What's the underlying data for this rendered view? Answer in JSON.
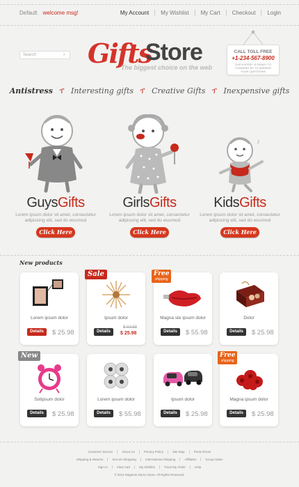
{
  "topbar": {
    "language": "Default",
    "welcome": "welcome msg!",
    "nav": [
      "My Account",
      "My Wishlist",
      "My Cart",
      "Checkout",
      "Login"
    ]
  },
  "search": {
    "placeholder": "Search"
  },
  "logo": {
    "part1": "Gifts",
    "part2": "Store",
    "tagline": "The biggest choice on the web"
  },
  "callbox": {
    "title": "CALL TOLL FREE",
    "phone": "+1-234-567-8900",
    "note": "OUR EXPERT IS READY TO STANDING BY TO ANSWER YOUR QUESTIONS"
  },
  "categories": [
    "Antistress",
    "Interesting gifts",
    "Creative Gifts",
    "Inexpensive gifts"
  ],
  "hero": [
    {
      "a": "Guys",
      "b": "Gifts",
      "desc1": "Lorem ipsum dolor sit amet, consectetur",
      "desc2": "adipiscing elit, sed do eiusmod",
      "button": "Click Here"
    },
    {
      "a": "Girls",
      "b": "Gifts",
      "desc1": "Lorem ipsum dolor sit amet, consectetur",
      "desc2": "adipiscing elit, sed do eiusmod",
      "button": "Click Here"
    },
    {
      "a": "Kids",
      "b": "Gifts",
      "desc1": "Lorem ipsum dolor sit amet, consectetur",
      "desc2": "adipiscing elit, sed do eiusmod",
      "button": "Click Here"
    }
  ],
  "new_products_title": "New products",
  "products": [
    {
      "name": "Lorem ipsum dolor",
      "details": "Details",
      "price": "$ 25.98",
      "badge": "",
      "icon": "photo-frame-icon"
    },
    {
      "name": "Ipsum dolor",
      "details": "Details",
      "old_price": "$ 32.58",
      "price": "$ 25.98",
      "badge": "Sale",
      "icon": "sun-clock-icon"
    },
    {
      "name": "Magna ste ipsum dolor",
      "details": "Details",
      "price": "$ 55.98",
      "badge": "Free",
      "badge_sub": "shipping",
      "icon": "usb-lips-icon"
    },
    {
      "name": "Dolor",
      "details": "Details",
      "price": "$ 25.98",
      "badge": "",
      "icon": "gift-box-icon"
    },
    {
      "name": "Sotipsum dolor",
      "details": "Details",
      "price": "$ 25.98",
      "badge": "New",
      "icon": "alarm-clock-icon"
    },
    {
      "name": "Lorem ipsum dolor",
      "details": "Details",
      "price": "$ 55.98",
      "badge": "",
      "icon": "balloon-clover-icon"
    },
    {
      "name": "Ipsum dolor",
      "details": "Details",
      "price": "$ 25.98",
      "badge": "",
      "icon": "toy-cars-icon"
    },
    {
      "name": "Magna ipsum dolor",
      "details": "Details",
      "price": "$ 25.98",
      "badge": "Free",
      "badge_sub": "shipping",
      "icon": "red-roses-icon"
    }
  ],
  "footer": {
    "row1": [
      "Customer Service",
      "About Us",
      "Privacy Policy",
      "Site Map",
      "Press Room"
    ],
    "row2": [
      "Shipping & Returns",
      "Secure Shopping",
      "International Shipping",
      "Affiliates",
      "Group Sales"
    ],
    "row3": [
      "Sign In",
      "View Cart",
      "My Wishlist",
      "Track My Order",
      "Help"
    ],
    "copyright": "© 2011 Magento Demo Store. All Rights Reserved."
  },
  "colors": {
    "accent": "#c62a1c",
    "button": "#d6381f",
    "dark": "#333333"
  }
}
